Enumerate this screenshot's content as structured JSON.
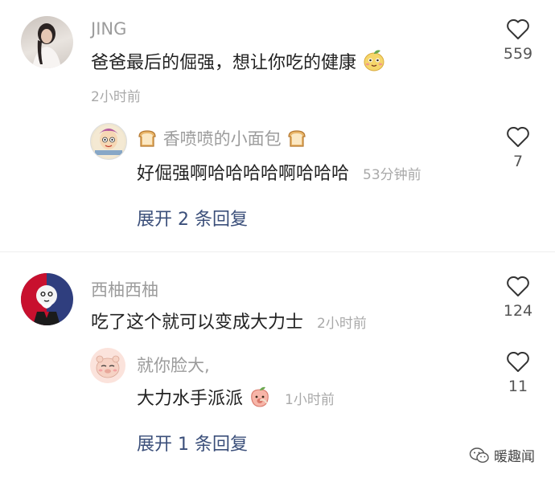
{
  "comments": [
    {
      "author": "JING",
      "text": "爸爸最后的倔强，想让你吃的健康",
      "time": "2小时前",
      "likes": "559",
      "replies": [
        {
          "author": "香喷喷的小面包",
          "text": "好倔强啊哈哈哈哈啊哈哈哈",
          "time": "53分钟前",
          "likes": "7"
        }
      ],
      "expand_label": "展开 2 条回复"
    },
    {
      "author": "西柚西柚",
      "text": "吃了这个就可以变成大力士",
      "time": "2小时前",
      "likes": "124",
      "replies": [
        {
          "author": "就你脸大,",
          "text": "大力水手派派",
          "time": "1小时前",
          "likes": "11"
        }
      ],
      "expand_label": "展开 1 条回复"
    }
  ],
  "watermark": {
    "text": "暖趣闻",
    "icon": "wechat-icon"
  },
  "icons": {
    "like": "heart-outline-icon",
    "emoji_1": "pear-emoji-icon",
    "emoji_2": "bread-emoji-icon",
    "emoji_3": "peach-emoji-icon"
  }
}
